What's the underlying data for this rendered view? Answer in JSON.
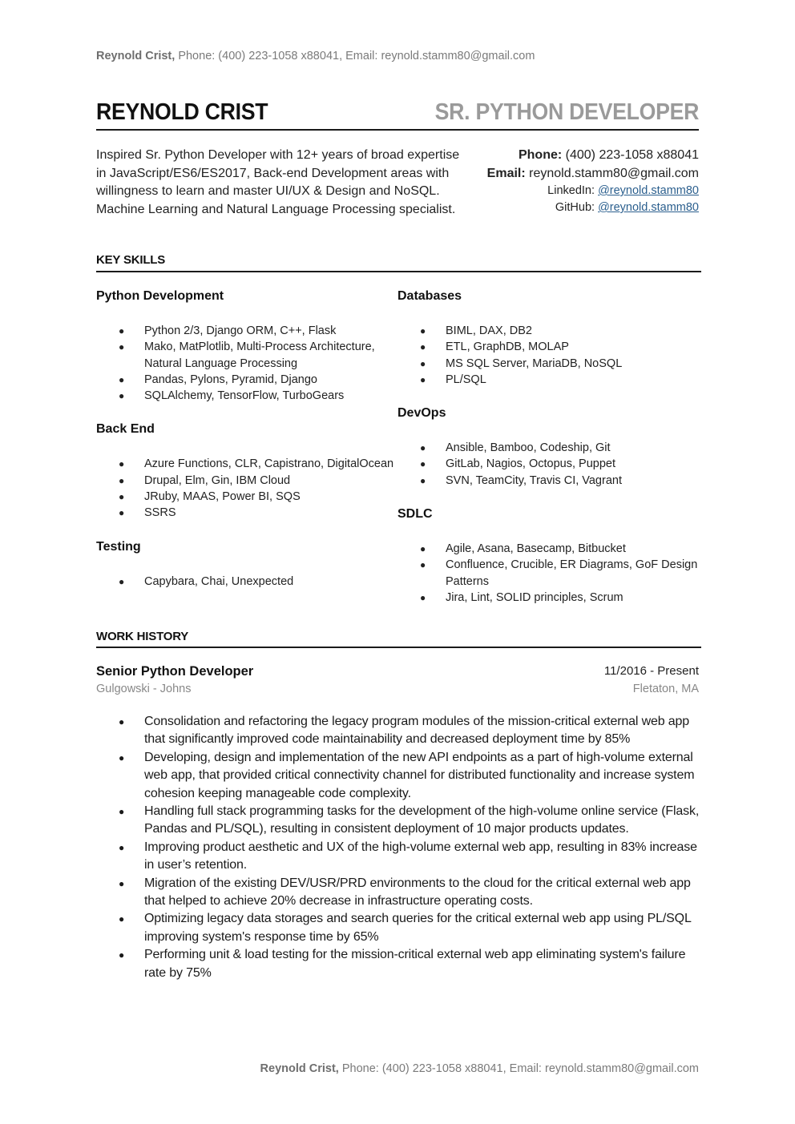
{
  "page_header": {
    "name": "Reynold Crist,",
    "rest": " Phone: (400) 223-1058 x88041, Email: reynold.stamm80@gmail.com"
  },
  "page_footer": {
    "name": "Reynold Crist,",
    "rest": " Phone: (400) 223-1058 x88041, Email: reynold.stamm80@gmail.com"
  },
  "header": {
    "name": "REYNOLD CRIST",
    "role": "SR. PYTHON DEVELOPER"
  },
  "summary": "Inspired Sr. Python Developer with 12+ years of broad expertise in JavaScript/ES6/ES2017, Back-end Development areas with willingness to learn and master UI/UX & Design and NoSQL. Machine Learning and Natural Language Processing specialist.",
  "contact": {
    "phone_label": "Phone:",
    "phone": " (400) 223-1058 x88041",
    "email_label": "Email:",
    "email": " reynold.stamm80@gmail.com",
    "linkedin_label": "LinkedIn: ",
    "linkedin": "@reynold.stamm80",
    "github_label": "GitHub: ",
    "github": "@reynold.stamm80",
    "link_color": "#2b5f8e"
  },
  "sections": {
    "skills_title": "KEY SKILLS",
    "work_title": "WORK HISTORY"
  },
  "skills": {
    "left": [
      {
        "heading": "Python Development",
        "items": [
          "Python 2/3, Django ORM, C++, Flask",
          "Mako, MatPlotlib, Multi-Process Architecture, Natural Language Processing",
          "Pandas, Pylons, Pyramid, Django",
          "SQLAlchemy, TensorFlow, TurboGears"
        ]
      },
      {
        "heading": "Back End",
        "items": [
          "Azure Functions, CLR, Capistrano, DigitalOcean",
          "Drupal, Elm, Gin, IBM Cloud",
          "JRuby, MAAS, Power BI, SQS",
          "SSRS"
        ]
      },
      {
        "heading": "Testing",
        "items": [
          "Capybara, Chai, Unexpected"
        ]
      }
    ],
    "right": [
      {
        "heading": "Databases",
        "items": [
          "BIML, DAX, DB2",
          "ETL, GraphDB, MOLAP",
          "MS SQL Server, MariaDB, NoSQL",
          "PL/SQL"
        ]
      },
      {
        "heading": "DevOps",
        "items": [
          "Ansible, Bamboo, Codeship, Git",
          "GitLab, Nagios, Octopus, Puppet",
          "SVN, TeamCity, Travis CI, Vagrant"
        ]
      },
      {
        "heading": "SDLC",
        "items": [
          "Agile, Asana, Basecamp, Bitbucket",
          "Confluence, Crucible, ER Diagrams, GoF Design Patterns",
          "Jira, Lint, SOLID principles, Scrum"
        ]
      }
    ]
  },
  "job": {
    "title": "Senior Python Developer",
    "dates": "11/2016 - Present",
    "company": "Gulgowski - Johns",
    "location": "Fletaton, MA",
    "duties": [
      "Consolidation and refactoring the legacy program modules of the mission-critical external web app that significantly improved code maintainability and decreased deployment time by 85%",
      "Developing, design and implementation of the new API endpoints as a part of high-volume external web app, that provided critical connectivity channel for distributed functionality and increase system cohesion keeping manageable code complexity.",
      "Handling full stack programming tasks for the development of the high-volume online service (Flask, Pandas and PL/SQL), resulting in consistent deployment of 10 major products updates.",
      "Improving product aesthetic and UX of the high-volume external web app, resulting in 83% increase in user’s retention.",
      "Migration of the existing DEV/USR/PRD environments to the cloud for the critical external web app that helped to achieve 20% decrease in infrastructure operating costs.",
      "Optimizing legacy data storages and search queries for the critical external web app using PL/SQL improving system's response time by 65%",
      "Performing unit & load testing for the mission-critical external web app eliminating system's failure rate by 75%"
    ]
  },
  "bullet_glyph": "●"
}
